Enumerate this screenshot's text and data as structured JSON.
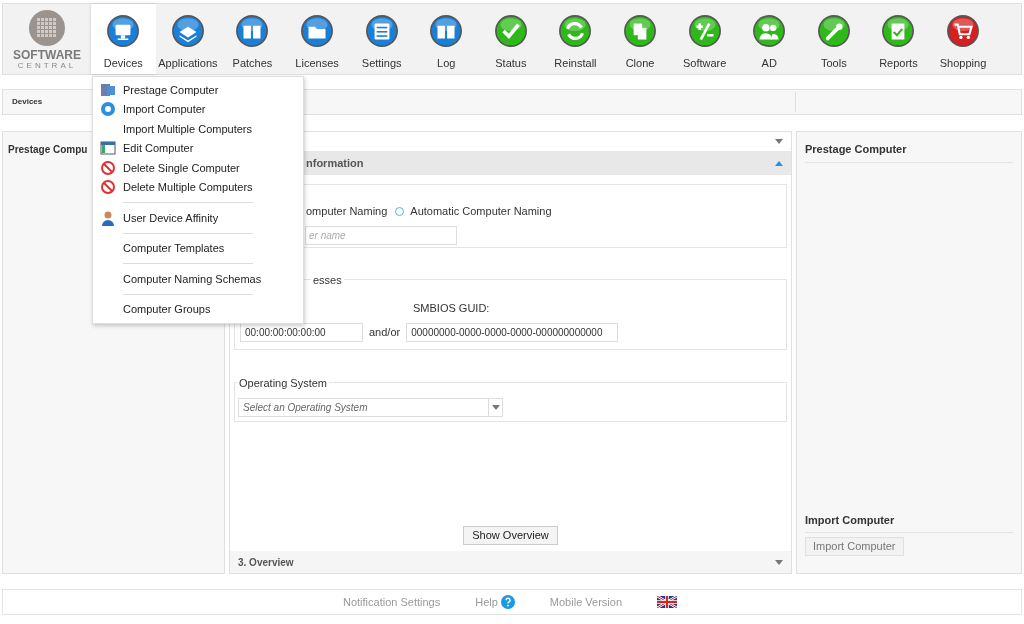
{
  "logo": {
    "name": "SOFTWARE",
    "tagline": "CENTRAL"
  },
  "nav": [
    {
      "label": "Devices",
      "color": "#1a7fd6",
      "selected": true
    },
    {
      "label": "Applications",
      "color": "#1a7fd6",
      "selected": false
    },
    {
      "label": "Patches",
      "color": "#1a7fd6",
      "selected": false
    },
    {
      "label": "Licenses",
      "color": "#1a7fd6",
      "selected": false
    },
    {
      "label": "Settings",
      "color": "#1a7fd6",
      "selected": false
    },
    {
      "label": "Log",
      "color": "#1a7fd6",
      "selected": false
    },
    {
      "label": "Status",
      "color": "#2fb81a",
      "selected": false
    },
    {
      "label": "Reinstall",
      "color": "#2fb81a",
      "selected": false
    },
    {
      "label": "Clone",
      "color": "#2fb81a",
      "selected": false
    },
    {
      "label": "Software",
      "color": "#2fb81a",
      "selected": false
    },
    {
      "label": "AD",
      "color": "#2fb81a",
      "selected": false
    },
    {
      "label": "Tools",
      "color": "#2fb81a",
      "selected": false
    },
    {
      "label": "Reports",
      "color": "#2fb81a",
      "selected": false
    },
    {
      "label": "Shopping",
      "color": "#d42020",
      "selected": false
    }
  ],
  "menu": [
    {
      "kind": "item",
      "label": "Prestage Computer"
    },
    {
      "kind": "item",
      "label": "Import Computer"
    },
    {
      "kind": "item",
      "label": "Import Multiple Computers"
    },
    {
      "kind": "item",
      "label": "Edit Computer"
    },
    {
      "kind": "item",
      "label": "Delete Single Computer"
    },
    {
      "kind": "item",
      "label": "Delete Multiple Computers"
    },
    {
      "kind": "separator"
    },
    {
      "kind": "item",
      "label": "User Device Affinity"
    },
    {
      "kind": "separator"
    },
    {
      "kind": "item",
      "label": "Computer Templates"
    },
    {
      "kind": "separator"
    },
    {
      "kind": "item",
      "label": "Computer Naming Schemas"
    },
    {
      "kind": "separator"
    },
    {
      "kind": "item",
      "label": "Computer Groups"
    }
  ],
  "breadcrumb": "Devices",
  "left_panel": {
    "title": "Prestage Compu"
  },
  "wizard": {
    "section_header": "nformation",
    "naming_label": "omputer Naming",
    "automatic_radio": {
      "label": "Automatic Computer Naming",
      "selected": false
    },
    "name_field": {
      "placeholder": "er name"
    },
    "addresses": {
      "legend": "esses",
      "guid_label": "SMBIOS GUID:",
      "mac_value": "00:00:00:00:00:00",
      "joiner": "and/or",
      "guid_value": "00000000-0000-0000-0000-000000000000"
    },
    "os": {
      "legend": "Operating System",
      "placeholder": "Select an Operating System"
    },
    "show_overview": "Show Overview",
    "overview_header": "3. Overview"
  },
  "right_panel": {
    "title": "Prestage Computer",
    "import_title": "Import Computer",
    "import_button": "Import Computer"
  },
  "footer": {
    "links": [
      "Notification Settings",
      "Help",
      "Mobile Version"
    ]
  }
}
